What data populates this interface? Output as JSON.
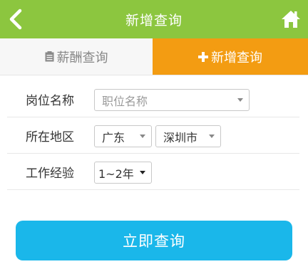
{
  "header": {
    "title": "新增查询",
    "back_icon": "chevron-left-icon",
    "home_icon": "home-icon",
    "bg_color": "#8cc63f"
  },
  "tabs": [
    {
      "label": "薪酬查询",
      "icon": "clipboard-icon",
      "active": false
    },
    {
      "label": "新增查询",
      "icon": "plus-icon",
      "active": true
    }
  ],
  "form": {
    "position": {
      "label": "岗位名称",
      "placeholder": "职位名称"
    },
    "region": {
      "label": "所在地区",
      "province": "广东",
      "city": "深圳市"
    },
    "experience": {
      "label": "工作经验",
      "value": "1~2年"
    }
  },
  "submit": {
    "label": "立即查询",
    "color": "#1ab7ea"
  },
  "accent_color": "#f39c12"
}
